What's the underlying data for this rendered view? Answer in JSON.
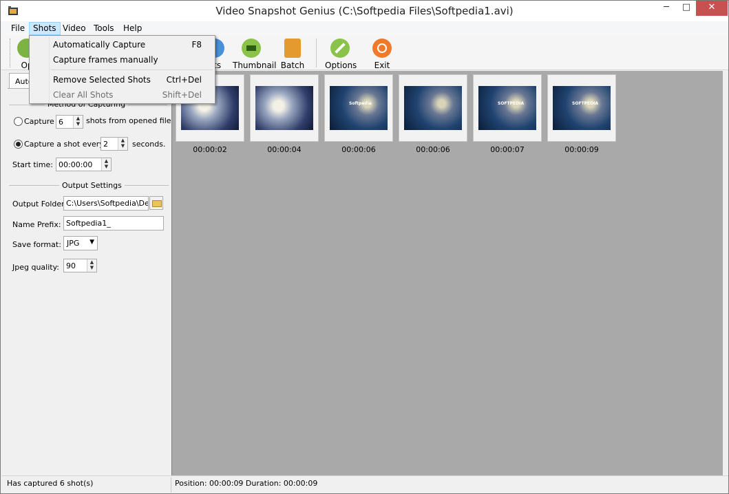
{
  "window": {
    "title": "Video Snapshot Genius (C:\\Softpedia Files\\Softpedia1.avi)",
    "min_glyph": "─",
    "max_glyph": "□",
    "close_glyph": "✕"
  },
  "menubar": {
    "items": [
      {
        "label": "File"
      },
      {
        "label": "Shots"
      },
      {
        "label": "Video"
      },
      {
        "label": "Tools"
      },
      {
        "label": "Help"
      }
    ]
  },
  "toolbar": {
    "buttons": [
      {
        "label": "Op",
        "icon": "open-icon",
        "color": "#7cb342"
      },
      {
        "label": "ots",
        "icon": "shots-icon",
        "color": "#4a90d9"
      },
      {
        "label": "Thumbnail",
        "icon": "thumbnail-icon",
        "color": "#8bc34a"
      },
      {
        "label": "Batch",
        "icon": "batch-icon",
        "color": "#e59a2f"
      },
      {
        "label": "Options",
        "icon": "wrench-icon",
        "color": "#8bc34a"
      },
      {
        "label": "Exit",
        "icon": "exit-icon",
        "color": "#f07a2a"
      }
    ]
  },
  "shots_menu": {
    "items": [
      {
        "label": "Automatically Capture",
        "shortcut": "F8",
        "enabled": true
      },
      {
        "label": "Capture frames manually",
        "shortcut": "",
        "enabled": true
      },
      {
        "label": "Remove Selected Shots",
        "shortcut": "Ctrl+Del",
        "enabled": true
      },
      {
        "label": "Clear All Shots",
        "shortcut": "Shift+Del",
        "enabled": false
      }
    ]
  },
  "left_panel": {
    "tab_label": "Auto",
    "method_group_title": "Method of Capturing",
    "capture_label": "Capture",
    "capture_count": "6",
    "shots_from_label": "shots from opened file.",
    "capture_every_label": "Capture a shot every",
    "capture_every_value": "2",
    "seconds_label": "seconds.",
    "start_time_label": "Start time:",
    "start_time_value": "00:00:00",
    "output_group_title": "Output Settings",
    "output_folder_label": "Output Folder:",
    "output_folder_value": "C:\\Users\\Softpedia\\Desl",
    "name_prefix_label": "Name Prefix:",
    "name_prefix_value": "Softpedia1_",
    "save_format_label": "Save format:",
    "save_format_value": "JPG",
    "jpeg_quality_label": "Jpeg quality:",
    "jpeg_quality_value": "90"
  },
  "shots": [
    {
      "time": "00:00:02",
      "watermark": ""
    },
    {
      "time": "00:00:04",
      "watermark": ""
    },
    {
      "time": "00:00:06",
      "watermark": "Softpedia"
    },
    {
      "time": "00:00:06",
      "watermark": ""
    },
    {
      "time": "00:00:07",
      "watermark": "SOFTPEDIA"
    },
    {
      "time": "00:00:09",
      "watermark": "SOFTPEDIA"
    }
  ],
  "statusbar": {
    "left": "Has captured 6 shot(s)",
    "right": "Position: 00:00:09 Duration: 00:00:09"
  }
}
